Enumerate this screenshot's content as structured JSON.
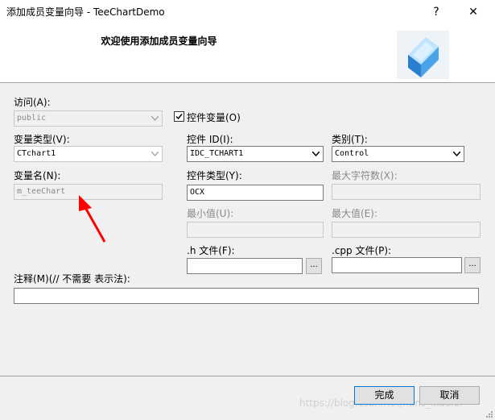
{
  "window": {
    "title": "添加成员变量向导 - TeeChartDemo",
    "help_glyph": "?",
    "close_glyph": "✕"
  },
  "banner": {
    "title": "欢迎使用添加成员变量向导",
    "icon": "cube-wizard-icon"
  },
  "form": {
    "access": {
      "label": "访问(A):",
      "value": "public"
    },
    "control_var": {
      "label": "控件变量(O)",
      "checked": true
    },
    "var_type": {
      "label": "变量类型(V):",
      "value": "CTchart1"
    },
    "control_id": {
      "label": "控件 ID(I):",
      "value": "IDC_TCHART1"
    },
    "category": {
      "label": "类别(T):",
      "value": "Control"
    },
    "var_name": {
      "label": "变量名(N):",
      "value": "m_teeChart"
    },
    "control_type": {
      "label": "控件类型(Y):",
      "value": "OCX"
    },
    "max_chars": {
      "label": "最大字符数(X):",
      "value": ""
    },
    "min_value": {
      "label": "最小值(U):",
      "value": ""
    },
    "max_value": {
      "label": "最大值(E):",
      "value": ""
    },
    "h_file": {
      "label": ".h 文件(F):",
      "value": "",
      "browse": "..."
    },
    "cpp_file": {
      "label": ".cpp 文件(P):",
      "value": "",
      "browse": "..."
    },
    "comment": {
      "label": "注释(M)(// 不需要 表示法):",
      "value": ""
    }
  },
  "buttons": {
    "finish": "完成",
    "cancel": "取消"
  },
  "watermark": "https://blog.csdn.net/hans_xiaolei",
  "colors": {
    "annotation_arrow": "#ff0000",
    "default_button_border": "#0078d7"
  }
}
